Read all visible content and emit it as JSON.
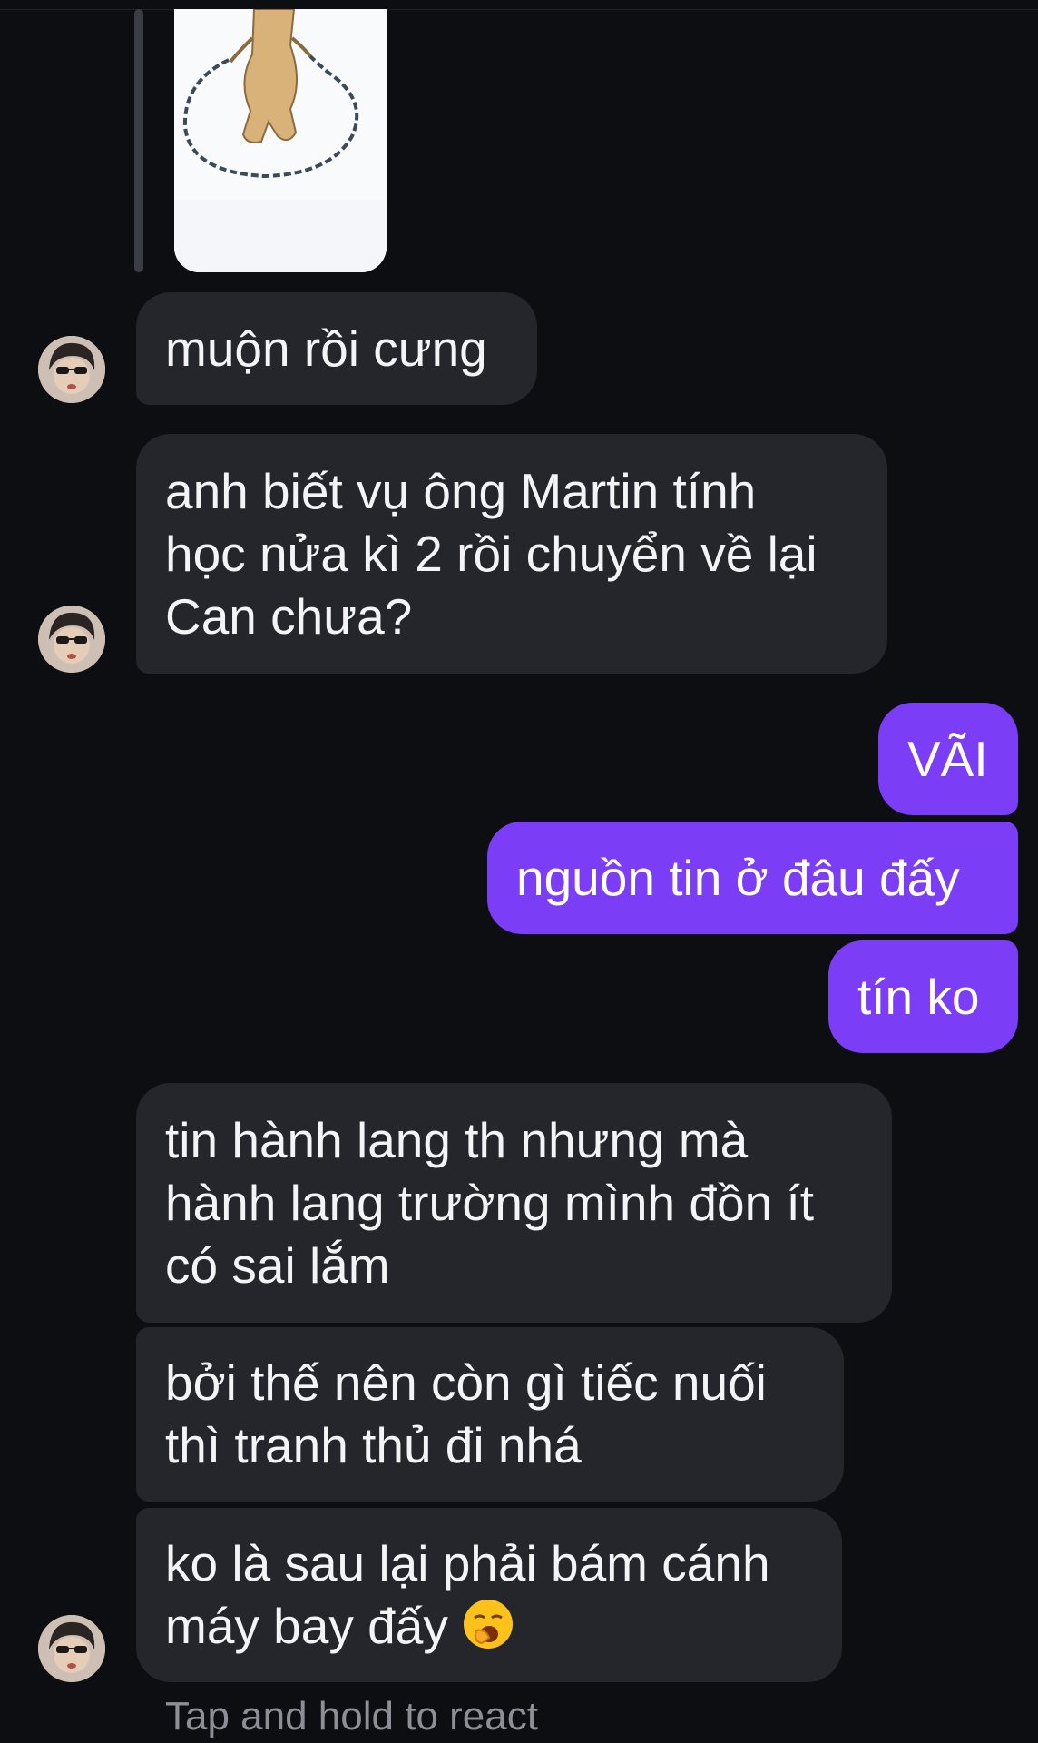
{
  "messages": {
    "m1": "muộn rồi cưng",
    "m2": [
      "anh biết vụ ông Martin tính",
      "học nửa kì 2 rồi chuyển về lại",
      "Can chưa?"
    ],
    "m3": "VÃI",
    "m4": "nguồn tin ở đâu đấy",
    "m5": "tín ko",
    "m6": [
      "tin hành lang th nhưng mà",
      "hành lang trường mình đồn ít",
      "có sai lắm"
    ],
    "m7": [
      "bởi thế nên còn gì tiếc nuối",
      "thì tranh thủ đi nhá"
    ],
    "m8": [
      "ko là sau lại phải bám cánh",
      "máy bay đấy"
    ]
  },
  "footer": {
    "hint": "Tap and hold to react"
  },
  "colors": {
    "background": "#0c0e12",
    "incoming": "#24262c",
    "outgoing": "#7c3df6",
    "hint": "#8c8f96"
  },
  "icons": {
    "emoji": "yawning-face-emoji",
    "avatar": "contact-avatar"
  }
}
